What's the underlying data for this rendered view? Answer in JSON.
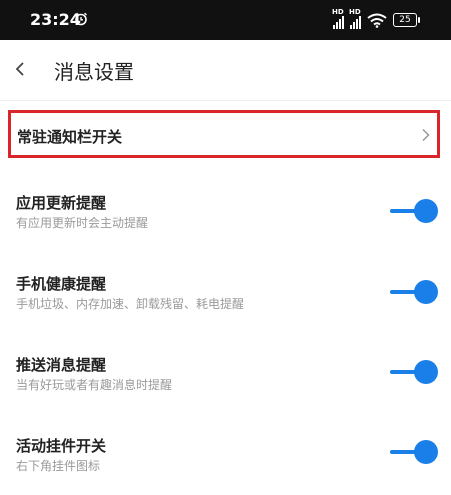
{
  "status_bar": {
    "time": "23:24",
    "signal_label_1": "HD",
    "signal_label_2": "HD",
    "battery": "25"
  },
  "header": {
    "title": "消息设置"
  },
  "highlight_item": {
    "label": "常驻通知栏开关"
  },
  "settings": [
    {
      "title": "应用更新提醒",
      "subtitle": "有应用更新时会主动提醒",
      "enabled": true
    },
    {
      "title": "手机健康提醒",
      "subtitle": "手机垃圾、内存加速、卸载残留、耗电提醒",
      "enabled": true
    },
    {
      "title": "推送消息提醒",
      "subtitle": "当有好玩或者有趣消息时提醒",
      "enabled": true
    },
    {
      "title": "活动挂件开关",
      "subtitle": "右下角挂件图标",
      "enabled": true
    }
  ],
  "colors": {
    "accent": "#1a7fe8",
    "highlight_border": "#d9262a",
    "status_bar_bg": "#111111"
  }
}
